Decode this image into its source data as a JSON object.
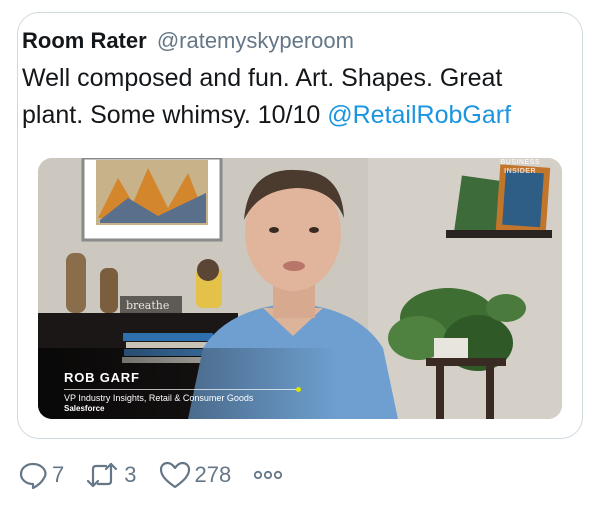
{
  "tweet": {
    "author_name": "Room Rater",
    "author_handle": "@ratemyskyperoom",
    "text": "Well composed and fun. Art. Shapes. Great plant. Some whimsy. 10/10 ",
    "mention": "@RetailRobGarf"
  },
  "media": {
    "lower_third_name": "ROB GARF",
    "lower_third_title": "VP Industry Insights, Retail & Consumer Goods",
    "lower_third_company": "Salesforce",
    "watermark_line1": "BUSINESS",
    "watermark_line2": "INSIDER",
    "mug_text": "breathe"
  },
  "actions": {
    "reply_count": "7",
    "retweet_count": "3",
    "like_count": "278",
    "reply_icon": "speech-bubble-icon",
    "retweet_icon": "retweet-arrows-icon",
    "like_icon": "heart-outline-icon",
    "more_icon": "three-dots-icon"
  },
  "colors": {
    "link": "#1b95e0",
    "muted": "#657786",
    "border": "#cfd9de",
    "text": "#14171a"
  }
}
